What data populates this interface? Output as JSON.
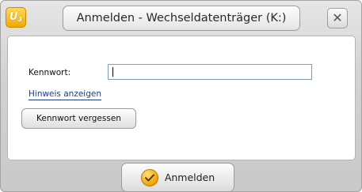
{
  "window": {
    "logo_text": "U",
    "logo_sub": "3",
    "title": "Anmelden - Wechseldatenträger (K:)",
    "close_symbol": "✕"
  },
  "form": {
    "password_label": "Kennwort:",
    "password_value": "",
    "hint_link": "Hinweis anzeigen",
    "forgot_button": "Kennwort vergessen"
  },
  "footer": {
    "login_button": "Anmelden",
    "login_icon": "checkmark-icon"
  },
  "colors": {
    "accent": "#f0a400",
    "link": "#1a3f8f"
  }
}
